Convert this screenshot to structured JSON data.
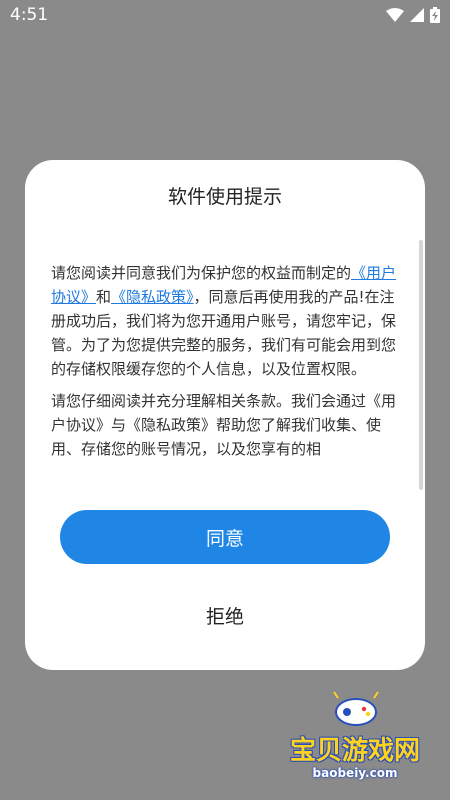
{
  "status_bar": {
    "time": "4:51"
  },
  "dialog": {
    "title": "软件使用提示",
    "paragraph1": {
      "part1": "请您阅读并同意我们为保护您的权益而制定的",
      "link_user_agreement": "《用户协议》",
      "and": "和",
      "link_privacy_policy": "《隐私政策》",
      "part2": "，同意后再使用我的产品!在注册成功后，我们将为您开通用户账号，请您牢记，保管。为了为您提供完整的服务，我们有可能会用到您的存储权限缓存您的个人信息，以及位置权限。"
    },
    "paragraph2": "请您仔细阅读并充分理解相关条款。我们会通过《用户协议》与《隐私政策》帮助您了解我们收集、使用、存储您的账号情况，以及您享有的相",
    "agree_label": "同意",
    "reject_label": "拒绝"
  },
  "watermark": {
    "text": "宝贝游戏网",
    "url": "baobeiy.com"
  },
  "colors": {
    "accent": "#1f86e6",
    "link": "#1f7ae0",
    "overlay": "#8a8a8a"
  }
}
